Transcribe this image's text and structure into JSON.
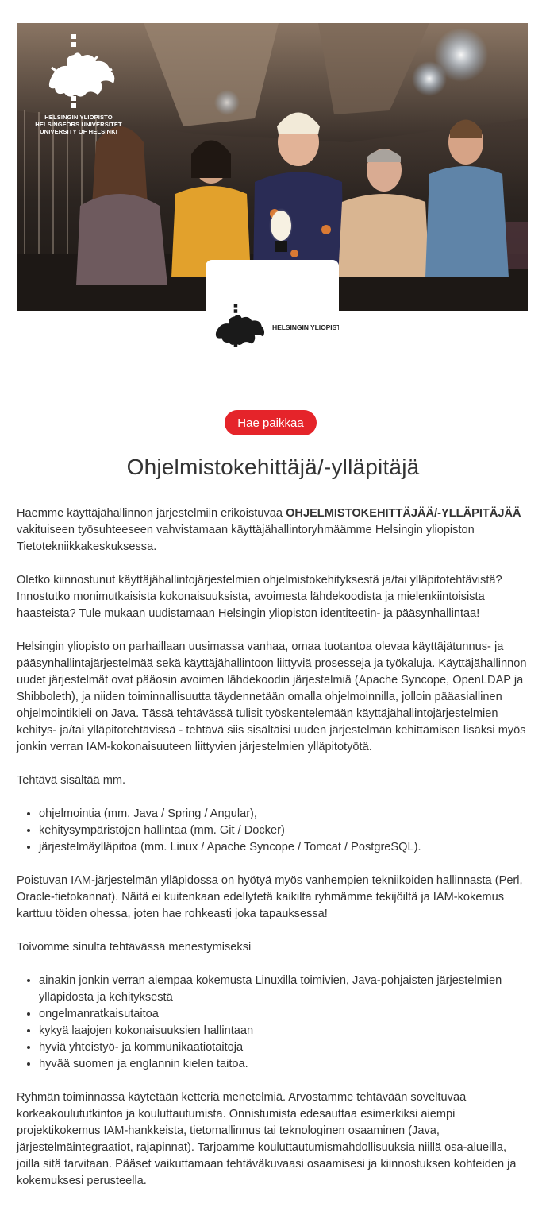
{
  "header": {
    "university_logo_lines": [
      "HELSINGIN YLIOPISTO",
      "HELSINGFORS UNIVERSITET",
      "UNIVERSITY OF HELSINKI"
    ],
    "company_logo_name": "HELSINGIN YLIOPISTO",
    "icon": "flame-lion-crest-icon"
  },
  "apply_button": {
    "label": "Hae paikkaa",
    "color": "#e5242a"
  },
  "job": {
    "title": "Ohjelmistokehittäjä/-ylläpitäjä",
    "intro_before": "Haemme käyttäjähallinnon järjestelmiin erikoistuvaa ",
    "intro_bold": "OHJELMISTOKEHITTÄJÄÄ/-YLLÄPITÄJÄÄ",
    "intro_after": " vakituiseen työsuhteeseen vahvistamaan käyttäjähallintoryhmäämme Helsingin yliopiston Tietotekniikkakeskuksessa.",
    "paragraph_2": "Oletko kiinnostunut käyttäjähallintojärjestelmien ohjelmistokehityksestä ja/tai ylläpitotehtävistä? Innostutko monimutkaisista kokonaisuuksista, avoimesta lähdekoodista ja mielenkiintoisista haasteista? Tule mukaan uudistamaan Helsingin yliopiston identiteetin- ja pääsynhallintaa!",
    "paragraph_3": "Helsingin yliopisto on parhaillaan uusimassa vanhaa, omaa tuotantoa olevaa käyttäjätunnus- ja pääsynhallintajärjestelmää sekä käyttäjähallintoon liittyviä prosesseja ja työkaluja. Käyttäjähallinnon uudet järjestelmät ovat pääosin avoimen lähdekoodin järjestelmiä (Apache Syncope, OpenLDAP ja Shibboleth), ja niiden toiminnallisuutta täydennetään omalla ohjelmoinnilla, jolloin pääasiallinen ohjelmointikieli on Java. Tässä tehtävässä tulisit työskentelemään käyttäjähallintojärjestelmien kehitys- ja/tai ylläpitotehtävissä - tehtävä siis sisältäisi uuden järjestelmän kehittämisen lisäksi myös jonkin verran IAM-kokonaisuuteen liittyvien järjestelmien ylläpitotyötä.",
    "tasks_heading": "Tehtävä sisältää mm.",
    "tasks": [
      "ohjelmointia (mm. Java / Spring / Angular),",
      "kehitysympäristöjen hallintaa (mm. Git / Docker)",
      "järjestelmäylläpitoa (mm. Linux / Apache Syncope / Tomcat / PostgreSQL)."
    ],
    "paragraph_legacy": "Poistuvan IAM-järjestelmän ylläpidossa on hyötyä myös vanhempien tekniikoiden hallinnasta (Perl, Oracle-tietokannat). Näitä ei kuitenkaan edellytetä kaikilta ryhmämme tekijöiltä ja IAM-kokemus karttuu töiden ohessa, joten hae rohkeasti joka tapauksessa!",
    "requirements_heading": "Toivomme sinulta tehtävässä menestymiseksi",
    "requirements": [
      "ainakin jonkin verran aiempaa kokemusta Linuxilla toimivien, Java-pohjaisten järjestelmien ylläpidosta ja kehityksestä",
      "ongelmanratkaisutaitoa",
      "kykyä laajojen kokonaisuuksien hallintaan",
      "hyviä yhteistyö- ja kommunikaatiotaitoja",
      "hyvää suomen ja englannin kielen taitoa."
    ],
    "paragraph_team": "Ryhmän toiminnassa käytetään ketteriä menetelmiä. Arvostamme tehtävään soveltuvaa korkeakoulututkintoa ja kouluttautumista. Onnistumista edesauttaa esimerkiksi aiempi projektikokemus IAM-hankkeista, tietomallinnus tai teknologinen osaaminen (Java, järjestelmäintegraatiot, rajapinnat). Tarjoamme kouluttautumismahdollisuuksia niillä osa-alueilla, joilla sitä tarvitaan. Pääset vaikuttamaan tehtäväkuvaasi osaamisesi ja kiinnostuksen kohteiden ja kokemuksesi perusteella."
  }
}
